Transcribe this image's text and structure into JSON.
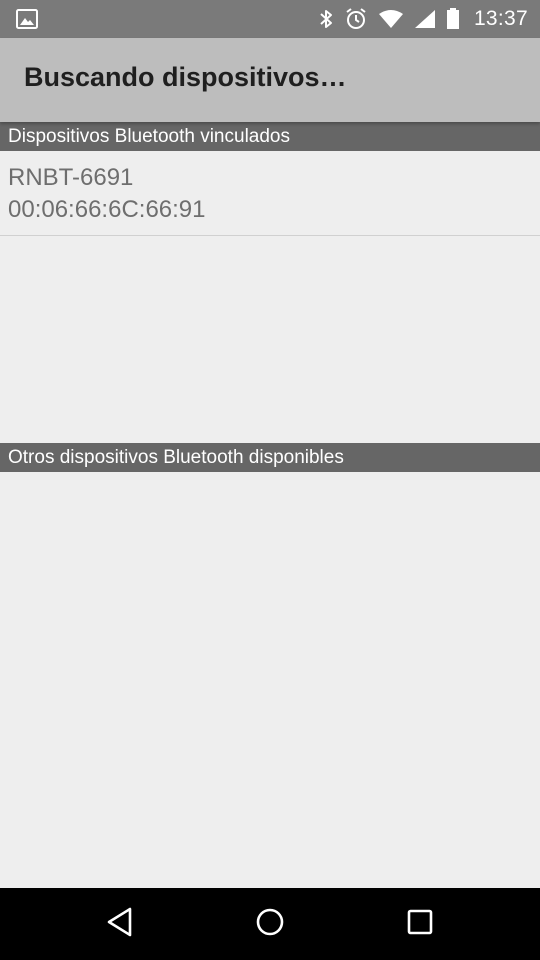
{
  "status_bar": {
    "time": "13:37",
    "icons": [
      "image-notification-icon",
      "bluetooth-icon",
      "alarm-icon",
      "wifi-icon",
      "signal-icon",
      "battery-icon"
    ]
  },
  "action_bar": {
    "title": "Buscando dispositivos…"
  },
  "paired_section": {
    "header": "Dispositivos Bluetooth vinculados",
    "devices": [
      {
        "name": "RNBT-6691",
        "address": "00:06:66:6C:66:91"
      }
    ]
  },
  "other_section": {
    "header": "Otros dispositivos Bluetooth disponibles",
    "devices": []
  },
  "navigation": {
    "icons": [
      "back-icon",
      "home-icon",
      "recents-icon"
    ]
  },
  "colors": {
    "status_bar": "#7a7a7a",
    "action_bar": "#bdbdbd",
    "section_header": "#666666",
    "background": "#eeeeee",
    "device_text": "#6e6e6e",
    "nav_bar": "#000000"
  }
}
